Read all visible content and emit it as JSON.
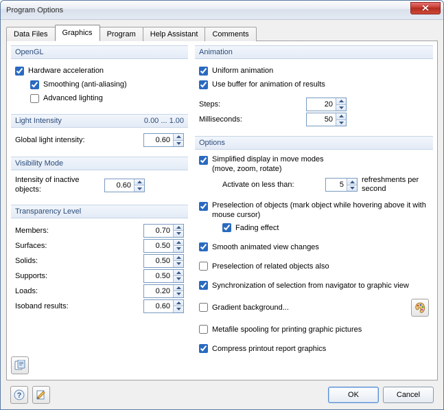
{
  "window": {
    "title": "Program Options"
  },
  "tabs": [
    "Data Files",
    "Graphics",
    "Program",
    "Help Assistant",
    "Comments"
  ],
  "activeTab": 1,
  "opengl": {
    "header": "OpenGL",
    "hardware_accel": "Hardware acceleration",
    "smoothing": "Smoothing (anti-aliasing)",
    "advanced_lighting": "Advanced lighting"
  },
  "light": {
    "header": "Light Intensity",
    "range": "0.00 ... 1.00",
    "global_label": "Global light intensity:",
    "global_value": "0.60"
  },
  "visibility": {
    "header": "Visibility Mode",
    "inactive_label": "Intensity of inactive objects:",
    "inactive_value": "0.60"
  },
  "transparency": {
    "header": "Transparency Level",
    "members_label": "Members:",
    "members_value": "0.70",
    "surfaces_label": "Surfaces:",
    "surfaces_value": "0.50",
    "solids_label": "Solids:",
    "solids_value": "0.50",
    "supports_label": "Supports:",
    "supports_value": "0.50",
    "loads_label": "Loads:",
    "loads_value": "0.20",
    "isoband_label": "Isoband results:",
    "isoband_value": "0.60"
  },
  "animation": {
    "header": "Animation",
    "uniform": "Uniform animation",
    "buffer": "Use buffer for animation of results",
    "steps_label": "Steps:",
    "steps_value": "20",
    "ms_label": "Milliseconds:",
    "ms_value": "50"
  },
  "options": {
    "header": "Options",
    "simplified": "Simplified display in move modes",
    "simplified_sub": "(move, zoom, rotate)",
    "activate_label": "Activate on less than:",
    "activate_value": "5",
    "activate_suffix": "refreshments per second",
    "preselection": "Preselection of objects (mark object while hovering above it with mouse cursor)",
    "fading": "Fading effect",
    "smooth": "Smooth animated view changes",
    "presel_related": "Preselection of related objects also",
    "sync_nav": "Synchronization of selection from navigator to graphic view",
    "gradient_bg": "Gradient background...",
    "metafile": "Metafile spooling for printing graphic pictures",
    "compress": "Compress printout report graphics"
  },
  "footer": {
    "ok": "OK",
    "cancel": "Cancel"
  }
}
